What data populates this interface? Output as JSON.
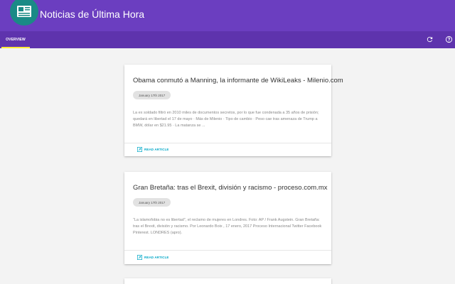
{
  "app": {
    "title": "Noticias de Última Hora"
  },
  "tabs": [
    {
      "label": "OVERVIEW"
    }
  ],
  "toolbar": {
    "refresh_icon": "refresh-icon",
    "help_icon": "help-icon"
  },
  "articles": [
    {
      "title": "Obama conmutó a Manning, la informante de WikiLeaks - Milenio.com",
      "date": "January 17th 2017",
      "body": "La ex soldado filtró en 2010 miles de documentos secretos, por lo que fue condenada a 35 años de prisión; quedará en libertad el 17 de mayo · Más de Milenio · Tipo de cambio · Peso cae tras amenaza de Trump a BMW, dólar en $21.95 · La matanza se ...",
      "action": "READ ARTICLE"
    },
    {
      "title": "Gran Bretaña: tras el Brexit, división y racismo - proceso.com.mx",
      "date": "January 17th 2017",
      "body": "“La islamofobia no es libertad”, el reclamo de mujeres en Londres. Foto: AP / Frank Augstein. Gran Bretaña: tras el Brexit, división y racismo. Por Leonardo Boix , 17 enero, 2017 Proceso Internacional Twitter Facebook Pinterest. LONDRES (apro).",
      "action": "READ ARTICLE"
    }
  ],
  "colors": {
    "primary": "#6b3ec0",
    "accent": "#ffeb3b",
    "link": "#00a7c7",
    "logo_bg": "#1a8a86"
  }
}
